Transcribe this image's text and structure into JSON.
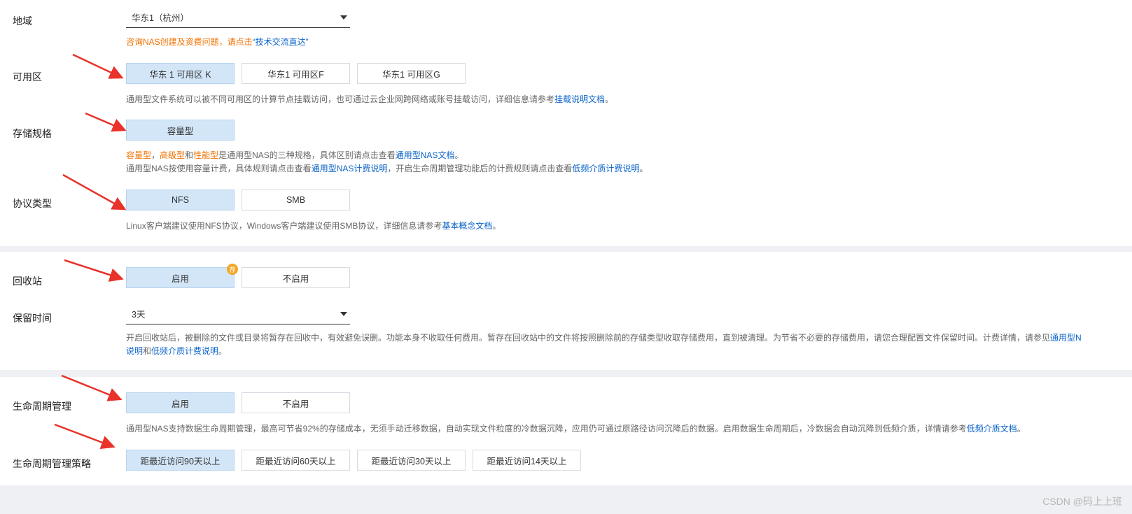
{
  "region": {
    "label": "地域",
    "value": "华东1（杭州）",
    "consult_prefix": "咨询NAS创建及资费问题，请点击",
    "consult_link": "“技术交流直达”"
  },
  "zone": {
    "label": "可用区",
    "options": [
      "华东 1 可用区 K",
      "华东1 可用区F",
      "华东1 可用区G"
    ],
    "help_text": "通用型文件系统可以被不同可用区的计算节点挂载访问，也可通过云企业网跨网络或账号挂载访问，详细信息请参考",
    "help_link": "挂载说明文档",
    "help_end": "。"
  },
  "storage": {
    "label": "存储规格",
    "option": "容量型",
    "line1_a": "容量型",
    "line1_b": "，",
    "line1_c": "高级型",
    "line1_d": "和",
    "line1_e": "性能型",
    "line1_f": "是通用型NAS的三种规格，具体区别请点击查看",
    "line1_link": "通用型NAS文档",
    "line1_end": "。",
    "line2_a": "通用型NAS按使用容量计费，具体规则请点击查看",
    "line2_link1": "通用型NAS计费说明",
    "line2_b": "，开启生命周期管理功能后的计费规则请点击查看",
    "line2_link2": "低频介质计费说明",
    "line2_end": "。"
  },
  "protocol": {
    "label": "协议类型",
    "options": [
      "NFS",
      "SMB"
    ],
    "help_text": "Linux客户端建议使用NFS协议，Windows客户端建议使用SMB协议，详细信息请参考",
    "help_link": "基本概念文档",
    "help_end": "。"
  },
  "recycle": {
    "label": "回收站",
    "options": [
      "启用",
      "不启用"
    ],
    "badge": "荐"
  },
  "retention": {
    "label": "保留时间",
    "value": "3天",
    "help_line1": "开启回收站后，被删除的文件或目录将暂存在回收中，有效避免误删。功能本身不收取任何费用。暂存在回收站中的文件将按照删除前的存储类型收取存储费用，直到被清理。为节省不必要的存储费用，请您合理配置文件保留时间。计费详情，请参见",
    "help_link1": "通用型N",
    "help_line2_link": "说明",
    "help_line2_and": "和",
    "help_link2": "低频介质计费说明",
    "help_end": "。"
  },
  "lifecycle": {
    "label": "生命周期管理",
    "options": [
      "启用",
      "不启用"
    ],
    "help_text": "通用型NAS支持数据生命周期管理，最高可节省92%的存储成本，无须手动迁移数据，自动实现文件粒度的冷数据沉降，应用仍可通过原路径访问沉降后的数据。启用数据生命周期后，冷数据会自动沉降到低频介质，详情请参考",
    "help_link": "低频介质文档",
    "help_end": "。"
  },
  "policy": {
    "label": "生命周期管理策略",
    "options": [
      "距最近访问90天以上",
      "距最近访问60天以上",
      "距最近访问30天以上",
      "距最近访问14天以上"
    ]
  },
  "watermark": "CSDN @码上上班",
  "colors": {
    "selected_bg": "#d3e6f8",
    "link": "#0a63c9",
    "orange": "#f07000",
    "arrow": "#e8322a"
  }
}
